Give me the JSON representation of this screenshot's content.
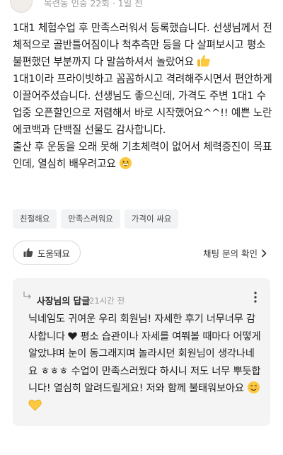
{
  "header": {
    "meta": "목련동 인증 22회 · 1일 전"
  },
  "review": {
    "line_block_1": "1대1 체험수업 후 만족스러워서 등록했습니다. 선생님께서 전체적으로 골반틀어짐이나 척추측만 등을 다 살펴보시고 평소 불편했던 부분까지 다 말씀하셔서 놀랐어요",
    "line_block_2a": "1대1이라 프라이빗하고 꼼꼼하시고 격려해주시면서 편안하게 이끌어주셨습니다. 선생님도 좋으신데, 가격도 주변 1대1 수업중 오픈할인으로 저렴해서 바로 시작했어요^^!! 예쁜 노란 에코백과 단백질 선물도 감사합니다.",
    "line_block_2b": "출산 후 운동을 오래 못해 기초체력이 없어서 체력증진이 목표인데, 열심히 배우려고요"
  },
  "tags": [
    "친절해요",
    "만족스러워요",
    "가격이 싸요"
  ],
  "actions": {
    "helpful_label": "도움돼요",
    "chat_label": "채팅 문의 확인"
  },
  "reply": {
    "title": "사장님의 답글",
    "time": "21시간 전",
    "text_a": "닉네임도 귀여운 우리 회원님! 자세한 후기 너무너무 감사합니다",
    "text_b": "평소 습관이나 자세를 여쭤볼 때마다 어떻게 알았냐며 눈이 동그래지며 놀라시던 회원님이 생각나네요 ㅎㅎㅎ 수업이 만족스러웠다 하시니 저도 너무 뿌듯합니다! 열심히 알려드릴게요! 저와 함께 불태워보아요"
  },
  "icons": {
    "avatar": "avatar",
    "thumbs_up": "thumbs-up-icon",
    "chevron": "chevron-right-icon",
    "reply_arrow": "reply-arrow-icon",
    "more": "more-vertical-icon"
  },
  "colors": {
    "text": "#1f1f1f",
    "muted": "#9a9a9a",
    "tag_bg": "#f2f3f5",
    "reply_bg": "#f4f4f5"
  }
}
